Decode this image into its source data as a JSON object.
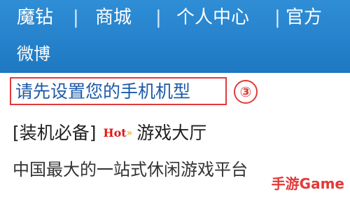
{
  "nav": {
    "row1": [
      "魔钻",
      "商城",
      "个人中心",
      "官方"
    ],
    "row2": "微博",
    "separator": "|"
  },
  "list": {
    "setup_link": "请先设置您的手机机型",
    "step_badge": "③",
    "app_tag": "[装机必备]",
    "hot_label": "Hot",
    "hot_arrow": "»",
    "app_name": "游戏大厅",
    "slogan": "中国最大的一站式休闲游戏平台"
  },
  "watermark": "手游Game",
  "colors": {
    "nav_bg": "#1e78c2",
    "highlight_border": "#e23a3a",
    "link": "#1e5aa8",
    "hot": "#e11717"
  }
}
